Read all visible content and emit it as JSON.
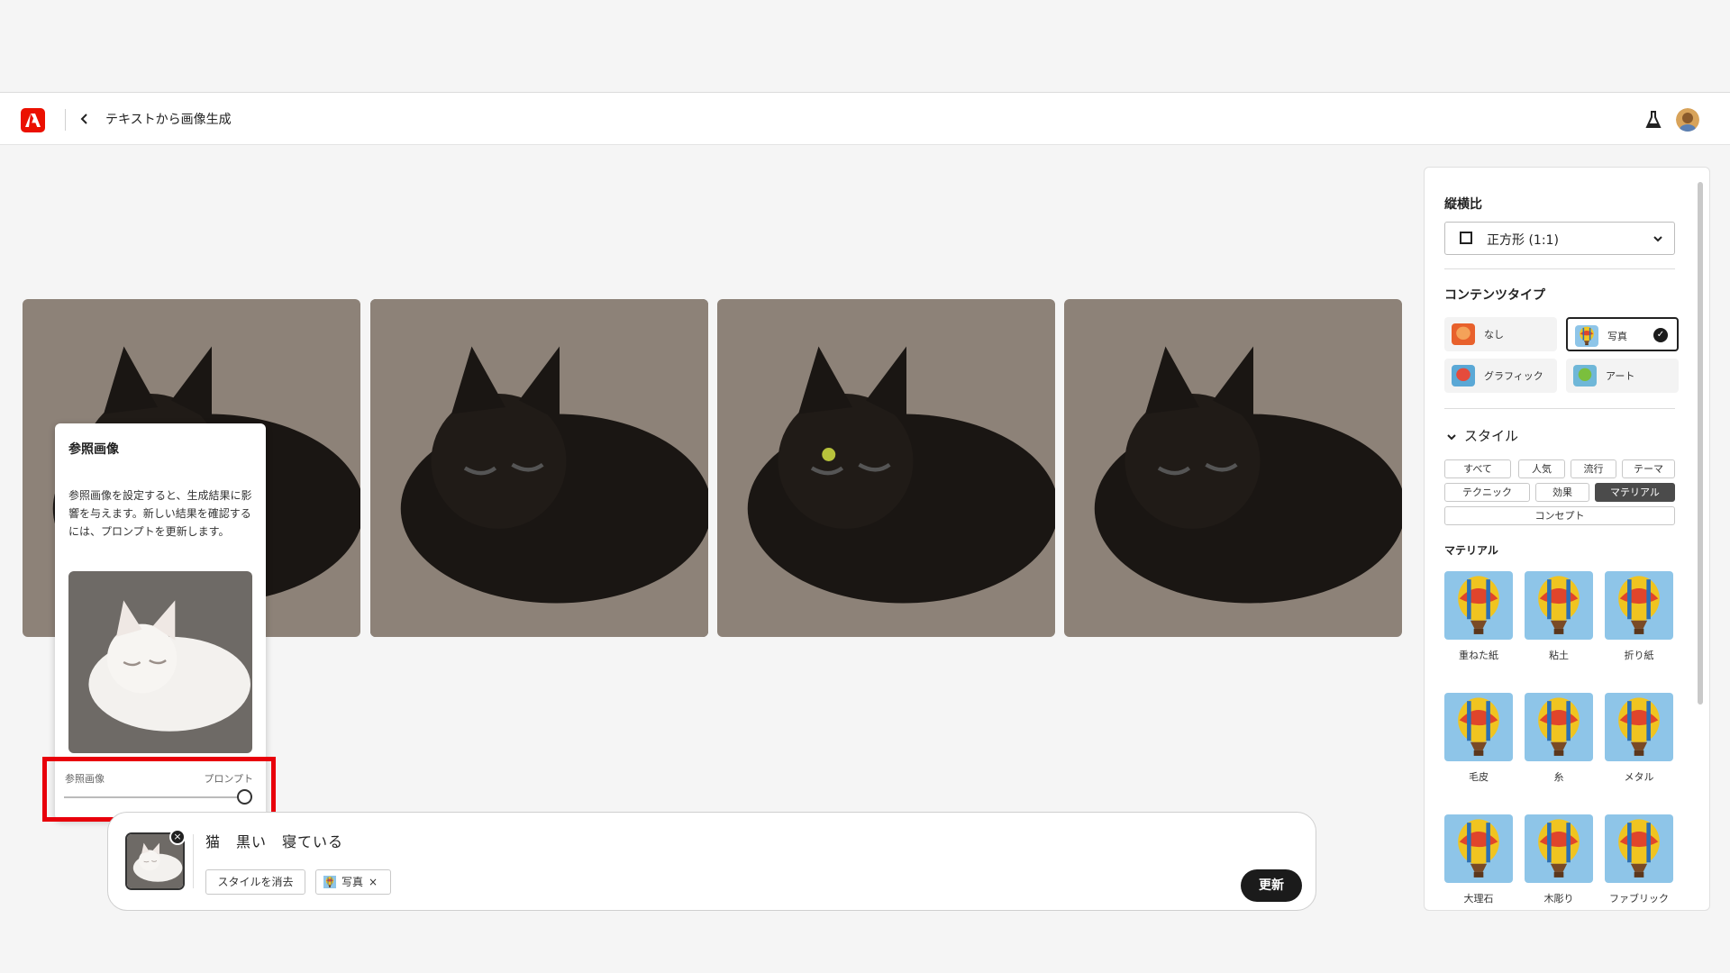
{
  "header": {
    "back_icon": "chevron-left-icon",
    "title": "テキストから画像生成",
    "labs_icon": "flask-icon",
    "avatar_icon": "avatar"
  },
  "gallery": {
    "images": [
      {
        "name": "generated-image-1",
        "desc": "black cat sleeping on fur"
      },
      {
        "name": "generated-image-2",
        "desc": "black cat sleeping on cushion"
      },
      {
        "name": "generated-image-3",
        "desc": "black cat lying, one eye open"
      },
      {
        "name": "generated-image-4",
        "desc": "black cat sleeping in bed"
      }
    ]
  },
  "reference_popover": {
    "title": "参照画像",
    "description": "参照画像を設定すると、生成結果に影響を与えます。新しい結果を確認するには、プロンプトを更新します。",
    "slider_left_label": "参照画像",
    "slider_right_label": "プロンプト",
    "slider_value": 1.0
  },
  "prompt": {
    "text": "猫　黒い　寝ている",
    "clear_style_label": "スタイルを消去",
    "style_chip_label": "写真",
    "style_chip_remove": "×",
    "thumb_remove": "×",
    "update_label": "更新"
  },
  "sidebar": {
    "aspect_heading": "縦横比",
    "aspect_value": "正方形 (1:1)",
    "content_heading": "コンテンツタイプ",
    "content_types": [
      {
        "label": "なし",
        "selected": false
      },
      {
        "label": "写真",
        "selected": true
      },
      {
        "label": "グラフィック",
        "selected": false
      },
      {
        "label": "アート",
        "selected": false
      }
    ],
    "style_heading": "スタイル",
    "style_tabs": [
      "すべて",
      "人気",
      "流行",
      "テーマ",
      "テクニック",
      "効果",
      "マテリアル",
      "コンセプト"
    ],
    "active_tab": "マテリアル",
    "material_heading": "マテリアル",
    "materials": [
      "重ねた紙",
      "粘土",
      "折り紙",
      "毛皮",
      "糸",
      "メタル",
      "大理石",
      "木彫り",
      "ファブリック"
    ]
  },
  "colors": {
    "brand": "#eb1000",
    "highlight": "#e8000b",
    "active_tab": "#4b4b4b",
    "button": "#1b1b1b"
  }
}
